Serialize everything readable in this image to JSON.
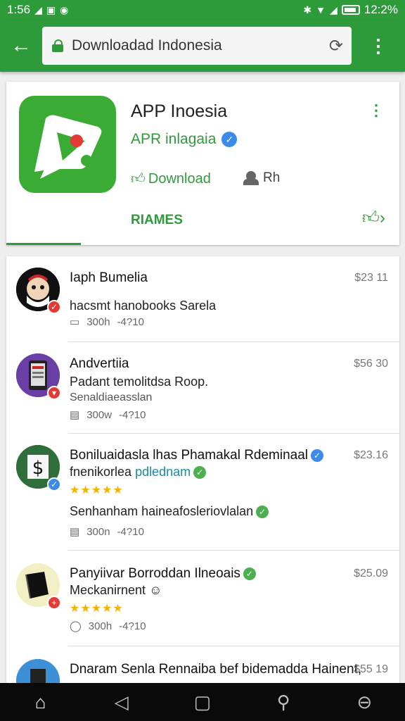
{
  "status_bar": {
    "time": "1:56",
    "battery_text": "12:2%",
    "left_icons": [
      "signal-icon",
      "notification-icon",
      "notification-icon"
    ],
    "right_icons": [
      "bluetooth-icon",
      "wifi-icon",
      "signal-icon",
      "battery-icon"
    ]
  },
  "toolbar": {
    "url": "Downloadad Indonesia",
    "back_icon": "arrow-left-icon",
    "reload_icon": "reload-icon",
    "menu_icon": "kebab-menu-icon"
  },
  "app_card": {
    "title": "APP Inoesia",
    "developer": "APR inlagaia",
    "download_label": "Download",
    "rating_label": "Rh",
    "tab_label": "RIAMES",
    "accent_color": "#2e9b3a"
  },
  "list": [
    {
      "title": "Iaph Bumelia",
      "line2": "hacsmt hanobooks Sarela",
      "meta": [
        "300h",
        "-4?10"
      ],
      "price": "$23 11"
    },
    {
      "title": "Andvertiia",
      "line2": "Padant temolitdsa Roop.",
      "line3": "Senaldiaeasslan",
      "meta": [
        "300w",
        "-4?10"
      ],
      "price": "$56 30"
    },
    {
      "title": "Boniluaidasla lhas Phamakal Rdeminaal",
      "line2a": "fnenikorlea",
      "line2b": "pdlednam",
      "stars": "★★★★★",
      "line3": "Senhanham haineafosleriovlalan",
      "meta": [
        "300n",
        "-4?10"
      ],
      "price": "$23.16"
    },
    {
      "title": "Panyiivar Borroddan Ilneoais",
      "line2": "Meckanirnent",
      "stars": "★★★★★",
      "meta": [
        "300h",
        "-4?10"
      ],
      "price": "$25.09"
    },
    {
      "title": "Dnaram Senla Rennaiba bef bidemadda Hainent,",
      "price": "$55 19"
    }
  ],
  "nav_bar": {
    "icons": [
      "home-icon",
      "back-triangle-icon",
      "recents-square-icon",
      "key-icon",
      "lock-icon"
    ]
  }
}
